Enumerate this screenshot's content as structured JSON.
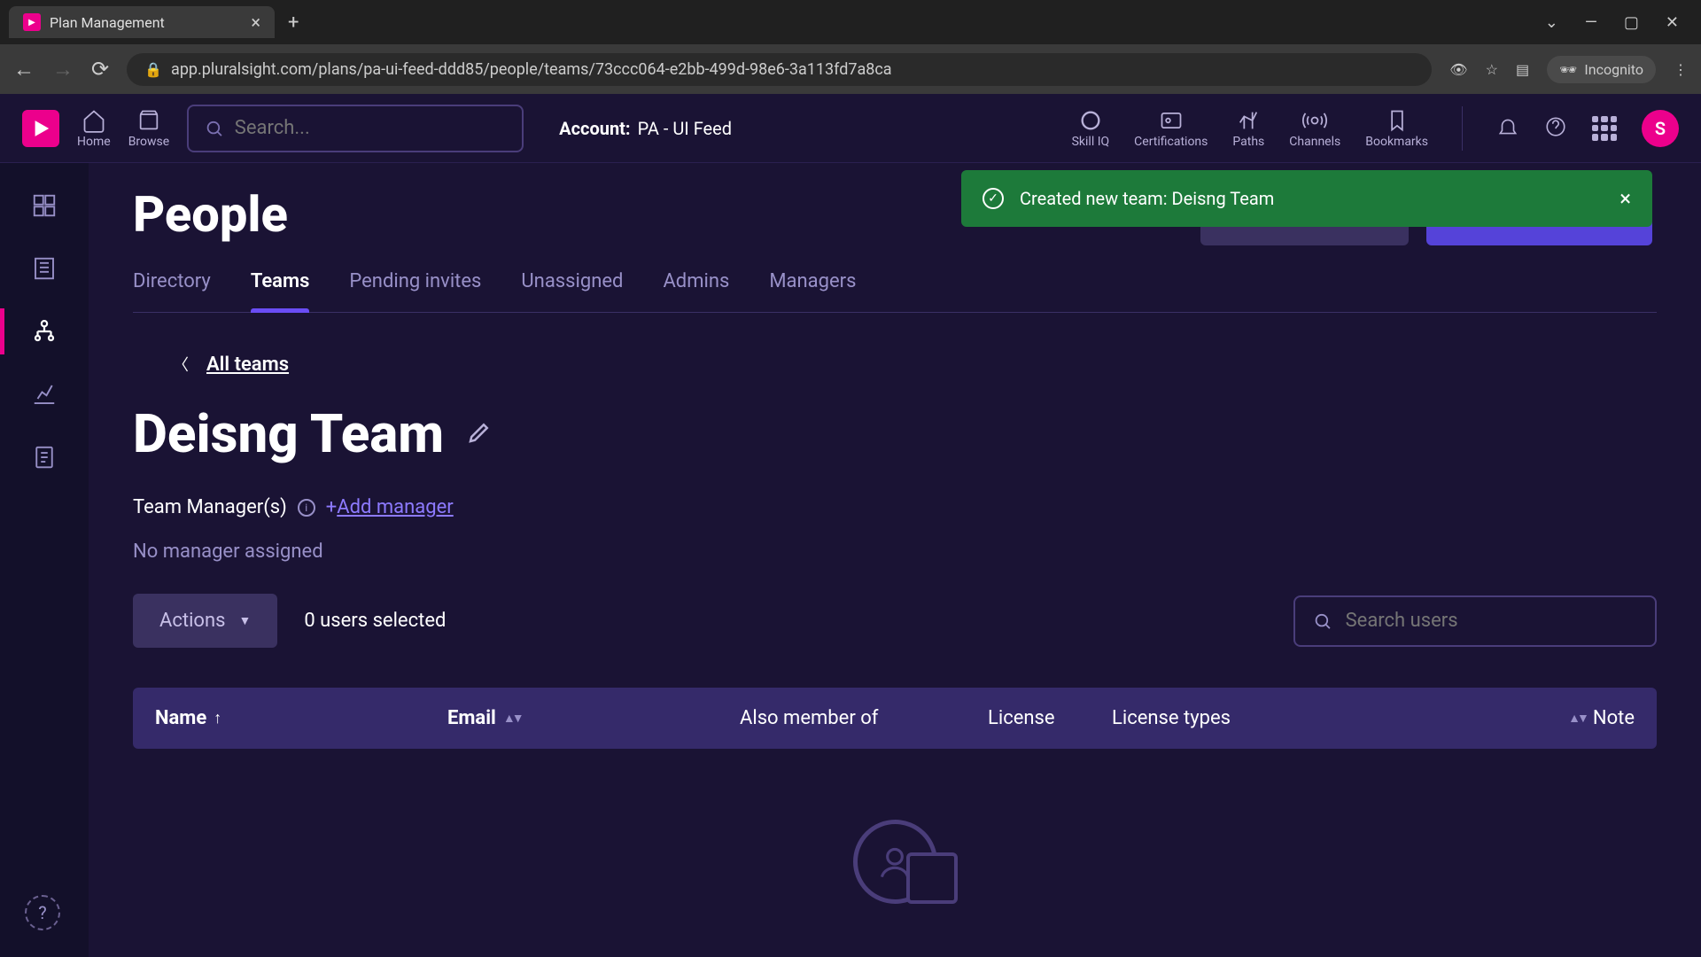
{
  "browser": {
    "tab_title": "Plan Management",
    "url": "app.pluralsight.com/plans/pa-ui-feed-ddd85/people/teams/73ccc064-e2bb-499d-98e6-3a113fd7a8ca",
    "incognito_label": "Incognito"
  },
  "header": {
    "nav_home": "Home",
    "nav_browse": "Browse",
    "search_placeholder": "Search...",
    "account_label": "Account:",
    "account_value": "PA - UI Feed",
    "nav_skilliq": "Skill IQ",
    "nav_certs": "Certifications",
    "nav_paths": "Paths",
    "nav_channels": "Channels",
    "nav_bookmarks": "Bookmarks",
    "avatar_initial": "S"
  },
  "toast": {
    "message": "Created new team: Deisng Team"
  },
  "page": {
    "title": "People",
    "tabs": {
      "directory": "Directory",
      "teams": "Teams",
      "pending": "Pending invites",
      "unassigned": "Unassigned",
      "admins": "Admins",
      "managers": "Managers"
    },
    "breadcrumb": "All teams",
    "team_name": "Deisng Team",
    "managers_label": "Team Manager(s)",
    "add_manager_prefix": "+",
    "add_manager": "Add manager",
    "no_manager": "No manager assigned",
    "actions_btn": "Actions",
    "selection": "0 users selected",
    "user_search_placeholder": "Search users",
    "columns": {
      "name": "Name",
      "email": "Email",
      "member_of": "Also member of",
      "license": "License",
      "license_types": "License types",
      "note": "Note"
    }
  }
}
